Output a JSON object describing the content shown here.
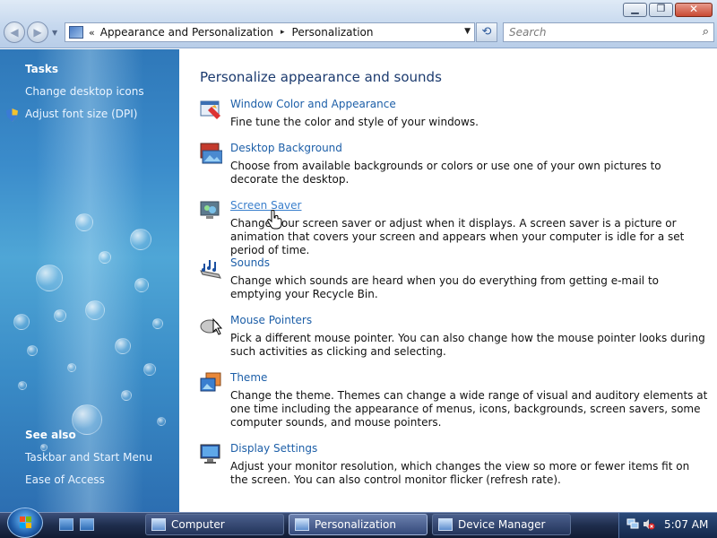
{
  "window": {
    "minimize_glyph": "▁",
    "maximize_glyph": "❐",
    "close_glyph": "✕"
  },
  "nav": {
    "back_glyph": "◀",
    "forward_glyph": "▶",
    "dropdown_glyph": "▼"
  },
  "address": {
    "overflow": "«",
    "segments": [
      "Appearance and Personalization",
      "Personalization"
    ],
    "arrow": "▸",
    "dropdown_glyph": "▼"
  },
  "refresh_glyph": "⟲",
  "search": {
    "placeholder": "Search",
    "icon_glyph": "⌕"
  },
  "sidebar": {
    "tasks_heading": "Tasks",
    "tasks": [
      "Change desktop icons",
      "Adjust font size (DPI)"
    ],
    "see_also_heading": "See also",
    "see_also": [
      "Taskbar and Start Menu",
      "Ease of Access"
    ]
  },
  "main": {
    "title": "Personalize appearance and sounds",
    "items": [
      {
        "icon": "window-color-icon",
        "label": "Window Color and Appearance",
        "desc": "Fine tune the color and style of your windows."
      },
      {
        "icon": "desktop-background-icon",
        "label": "Desktop Background",
        "desc": "Choose from available backgrounds or colors or use one of your own pictures to decorate the desktop."
      },
      {
        "icon": "screen-saver-icon",
        "label": "Screen Saver",
        "desc": "Change your screen saver or adjust when it displays. A screen saver is a picture or animation that covers your screen and appears when your computer is idle for a set period of time."
      },
      {
        "icon": "sounds-icon",
        "label": "Sounds",
        "desc": "Change which sounds are heard when you do everything from getting e-mail to emptying your Recycle Bin."
      },
      {
        "icon": "mouse-pointers-icon",
        "label": "Mouse Pointers",
        "desc": "Pick a different mouse pointer. You can also change how the mouse pointer looks during such activities as clicking and selecting."
      },
      {
        "icon": "theme-icon",
        "label": "Theme",
        "desc": "Change the theme. Themes can change a wide range of visual and auditory elements at one time including the appearance of menus, icons, backgrounds, screen savers, some computer sounds, and mouse pointers."
      },
      {
        "icon": "display-settings-icon",
        "label": "Display Settings",
        "desc": "Adjust your monitor resolution, which changes the view so more or fewer items fit on the screen. You can also control monitor flicker (refresh rate)."
      }
    ]
  },
  "taskbar": {
    "buttons": [
      "Computer",
      "Personalization",
      "Device Manager"
    ],
    "active_index": 1,
    "clock": "5:07 AM"
  },
  "colors": {
    "link": "#1d5fa8",
    "title": "#1b3a6e",
    "sidebar_text": "#eaf4ff"
  }
}
